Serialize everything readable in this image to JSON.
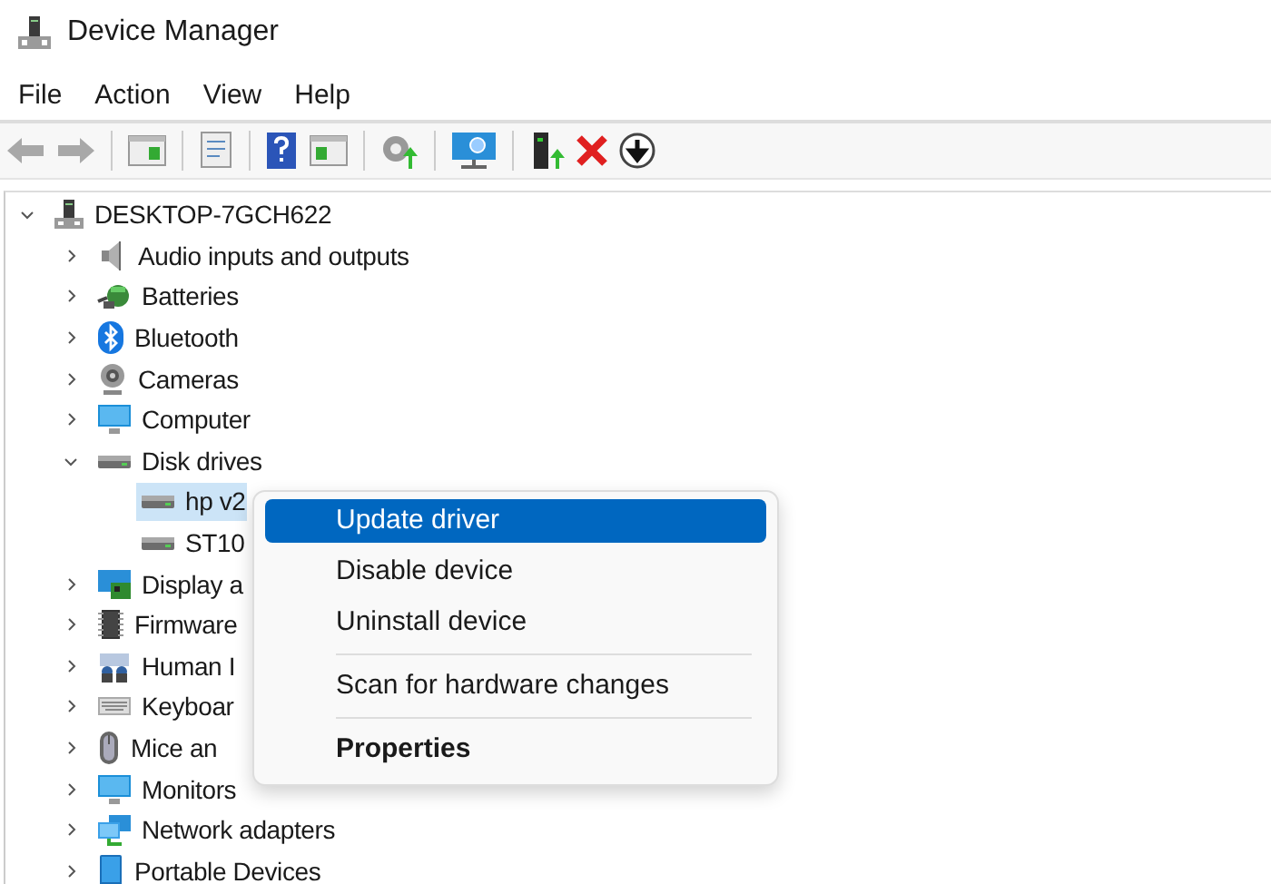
{
  "window": {
    "title": "Device Manager"
  },
  "menu_bar": [
    "File",
    "Action",
    "View",
    "Help"
  ],
  "toolbar": {
    "navigation_disabled": true
  },
  "tree": {
    "label": "DESKTOP-7GCH622",
    "expanded": true,
    "selected": false,
    "children": [
      {
        "label": "Audio inputs and outputs",
        "expanded": false,
        "selected": false
      },
      {
        "label": "Batteries",
        "expanded": false,
        "selected": false
      },
      {
        "label": "Bluetooth",
        "expanded": false,
        "selected": false
      },
      {
        "label": "Cameras",
        "expanded": false,
        "selected": false
      },
      {
        "label": "Computer",
        "expanded": false,
        "selected": false
      },
      {
        "label": "Disk drives",
        "expanded": true,
        "selected": false,
        "children": [
          {
            "label": "hp v2",
            "selected": true
          },
          {
            "label": "ST10",
            "selected": false
          }
        ]
      },
      {
        "label": "Display a",
        "expanded": false,
        "selected": false
      },
      {
        "label": "Firmware",
        "expanded": false,
        "selected": false
      },
      {
        "label": "Human I",
        "expanded": false,
        "selected": false
      },
      {
        "label": "Keyboar",
        "expanded": false,
        "selected": false
      },
      {
        "label": "Mice an",
        "expanded": false,
        "selected": false
      },
      {
        "label": "Monitors",
        "expanded": false,
        "selected": false
      },
      {
        "label": "Network adapters",
        "expanded": false,
        "selected": false
      },
      {
        "label": "Portable Devices",
        "expanded": false,
        "selected": false
      }
    ]
  },
  "context_menu": [
    {
      "kind": "item",
      "label": "Update driver",
      "selected": true,
      "default": false
    },
    {
      "kind": "item",
      "label": "Disable device",
      "selected": false,
      "default": false
    },
    {
      "kind": "item",
      "label": "Uninstall device",
      "selected": false,
      "default": false
    },
    {
      "kind": "separator"
    },
    {
      "kind": "item",
      "label": "Scan for hardware changes",
      "selected": false,
      "default": false
    },
    {
      "kind": "separator"
    },
    {
      "kind": "item",
      "label": "Properties",
      "selected": false,
      "default": true
    }
  ]
}
